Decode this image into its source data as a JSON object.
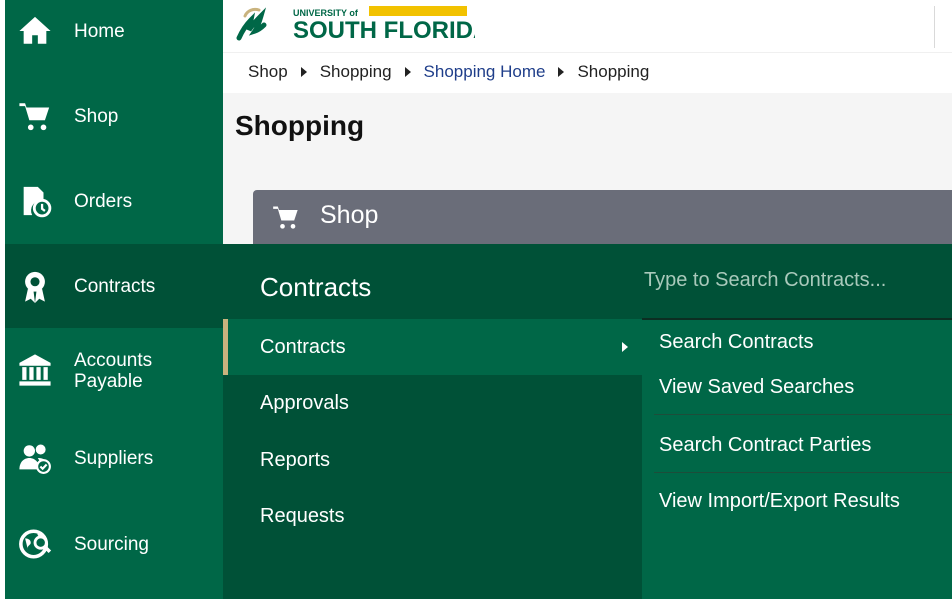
{
  "brand": {
    "university_line": "UNIVERSITY of",
    "name": "SOUTH FLORIDA",
    "green": "#006747",
    "dark_green": "#005137",
    "gold": "#c9b37e"
  },
  "sidebar": {
    "items": [
      {
        "label": "Home",
        "icon": "home-icon"
      },
      {
        "label": "Shop",
        "icon": "cart-icon"
      },
      {
        "label": "Orders",
        "icon": "document-clock-icon"
      },
      {
        "label": "Contracts",
        "icon": "award-ribbon-icon",
        "active": true
      },
      {
        "label_line1": "Accounts",
        "label_line2": "Payable",
        "icon": "bank-icon"
      },
      {
        "label": "Suppliers",
        "icon": "people-check-icon"
      },
      {
        "label": "Sourcing",
        "icon": "globe-search-icon"
      }
    ]
  },
  "breadcrumb": [
    "Shop",
    "Shopping",
    "Shopping Home",
    "Shopping"
  ],
  "page": {
    "title": "Shopping",
    "panel_title": "Shop"
  },
  "flyout": {
    "title": "Contracts",
    "items": [
      {
        "label": "Contracts",
        "active": true
      },
      {
        "label": "Approvals"
      },
      {
        "label": "Reports"
      },
      {
        "label": "Requests"
      }
    ]
  },
  "submenu": {
    "search_placeholder": "Type to Search Contracts...",
    "links": [
      "Search Contracts",
      "View Saved Searches",
      "Search Contract Parties",
      "View Import/Export Results"
    ]
  }
}
